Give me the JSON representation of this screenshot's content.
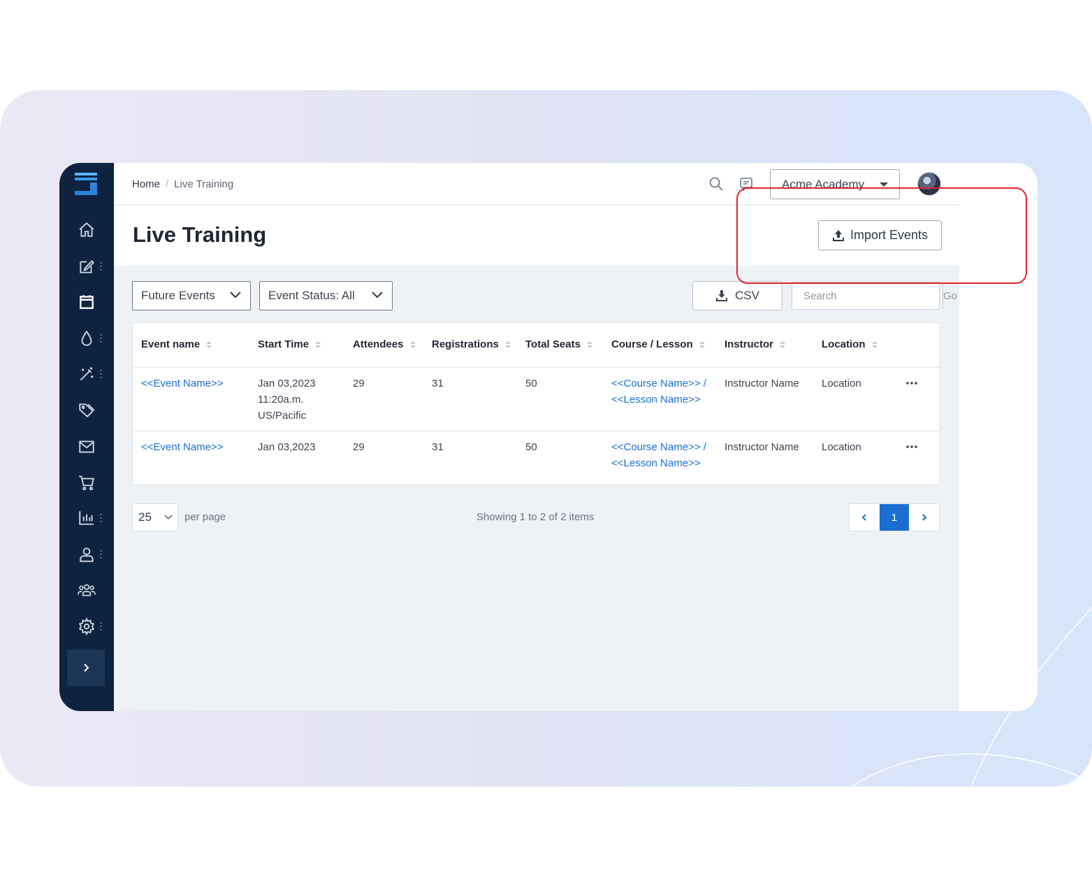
{
  "topbar": {
    "breadcrumb": {
      "home": "Home",
      "separator": "/",
      "current": "Live Training"
    },
    "org_select": "Acme Academy"
  },
  "header": {
    "title": "Live Training",
    "import_label": "Import Events"
  },
  "filters": {
    "events_filter": "Future Events",
    "status_filter": "Event Status: All",
    "csv_label": "CSV",
    "search_placeholder": "Search",
    "go_label": "Go"
  },
  "table": {
    "columns": [
      "Event name",
      "Start Time",
      "Attendees",
      "Registrations",
      "Total Seats",
      "Course / Lesson",
      "Instructor",
      "Location"
    ],
    "rows": [
      {
        "event_name": "<<Event Name>>",
        "start_time": [
          "Jan 03,2023",
          "11:20a.m.",
          "US/Pacific"
        ],
        "attendees": "29",
        "registrations": "31",
        "total_seats": "50",
        "course": "<<Course Name>> /",
        "lesson": "<<Lesson Name>>",
        "instructor": "Instructor Name",
        "location": "Location"
      },
      {
        "event_name": "<<Event Name>>",
        "start_time": [
          "Jan 03,2023"
        ],
        "attendees": "29",
        "registrations": "31",
        "total_seats": "50",
        "course": "<<Course Name>> /",
        "lesson": "<<Lesson Name>>",
        "instructor": "Instructor Name",
        "location": "Location"
      }
    ]
  },
  "pager": {
    "page_size": "25",
    "per_page_label": "per page",
    "showing": "Showing 1 to 2 of 2 items",
    "current_page": "1"
  },
  "colors": {
    "sidebar_bg": "#0e2340",
    "link": "#1a6fd1",
    "highlight": "#e0242c"
  },
  "icons": [
    "app-logo-icon",
    "home-icon",
    "edit-icon",
    "calendar-icon",
    "drop-icon",
    "magic-wand-icon",
    "tag-icon",
    "mail-icon",
    "cart-icon",
    "bar-chart-icon",
    "user-icon",
    "users-group-icon",
    "gear-icon",
    "chevron-right-icon",
    "search-icon",
    "chat-icon",
    "upload-icon",
    "download-icon",
    "more-icon"
  ]
}
